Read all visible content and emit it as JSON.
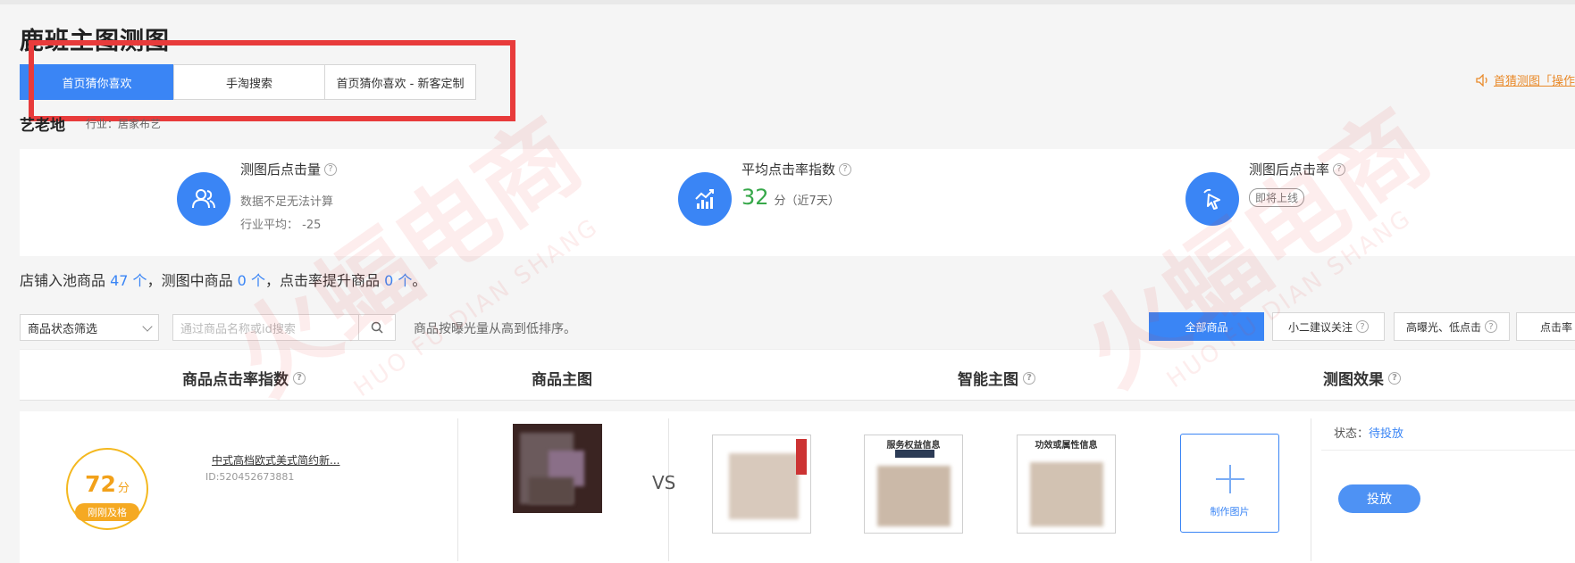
{
  "page": {
    "title": "鹿班主图测图"
  },
  "tabs": [
    {
      "label": "首页猜你喜欢",
      "active": true
    },
    {
      "label": "手淘搜索",
      "active": false
    },
    {
      "label": "首页猜你喜欢 - 新客定制",
      "active": false
    }
  ],
  "top_link": {
    "text": "首猜测图「操作",
    "icon": "speaker-icon"
  },
  "shop": {
    "name": "艺老地",
    "industry": "行业：居家布艺"
  },
  "stats": [
    {
      "title": "测图后点击量",
      "line1": "数据不足无法计算",
      "line2": "行业平均： -25",
      "icon": "users-icon"
    },
    {
      "title": "平均点击率指数",
      "value": "32",
      "unit": "分（近7天）",
      "icon": "trend-chart-icon"
    },
    {
      "title": "测图后点击率",
      "pill": "即将上线",
      "icon": "cursor-click-icon"
    }
  ],
  "summary": {
    "prefix": "店铺入池商品",
    "count1": "47 个",
    "mid1": "，测图中商品",
    "count2": "0 个",
    "mid2": "，点击率提升商品",
    "count3": "0 个",
    "suffix": "。"
  },
  "filters": {
    "status_select": "商品状态筛选",
    "search_placeholder": "通过商品名称或id搜索",
    "sort_text": "商品按曝光量从高到低排序。",
    "buttons": [
      {
        "label": "全部商品",
        "active": true
      },
      {
        "label": "小二建议关注",
        "active": false
      },
      {
        "label": "高曝光、低点击",
        "active": false
      },
      {
        "label": "点击率",
        "active": false
      }
    ]
  },
  "table": {
    "headers": [
      "商品点击率指数",
      "商品主图",
      "智能主图",
      "测图效果"
    ],
    "rows": [
      {
        "score": "72",
        "score_unit": "分",
        "badge": "刚刚及格",
        "title": "中式高档欧式美式简约新...",
        "id": "ID:520452673881",
        "vs": "VS",
        "thumbs": [
          "",
          "服务权益信息",
          "功效或属性信息"
        ],
        "make_label": "制作图片",
        "status_label": "状态：",
        "status_value": "待投放",
        "action": "投放"
      }
    ]
  },
  "watermark": {
    "text": "火蝠电商",
    "sub": "HUO FU DIAN SHANG"
  },
  "colors": {
    "primary": "#3a85f5",
    "highlight": "#e83b3b",
    "score": "#f2a11a",
    "good": "#37a84a",
    "link": "#e98a2a"
  }
}
